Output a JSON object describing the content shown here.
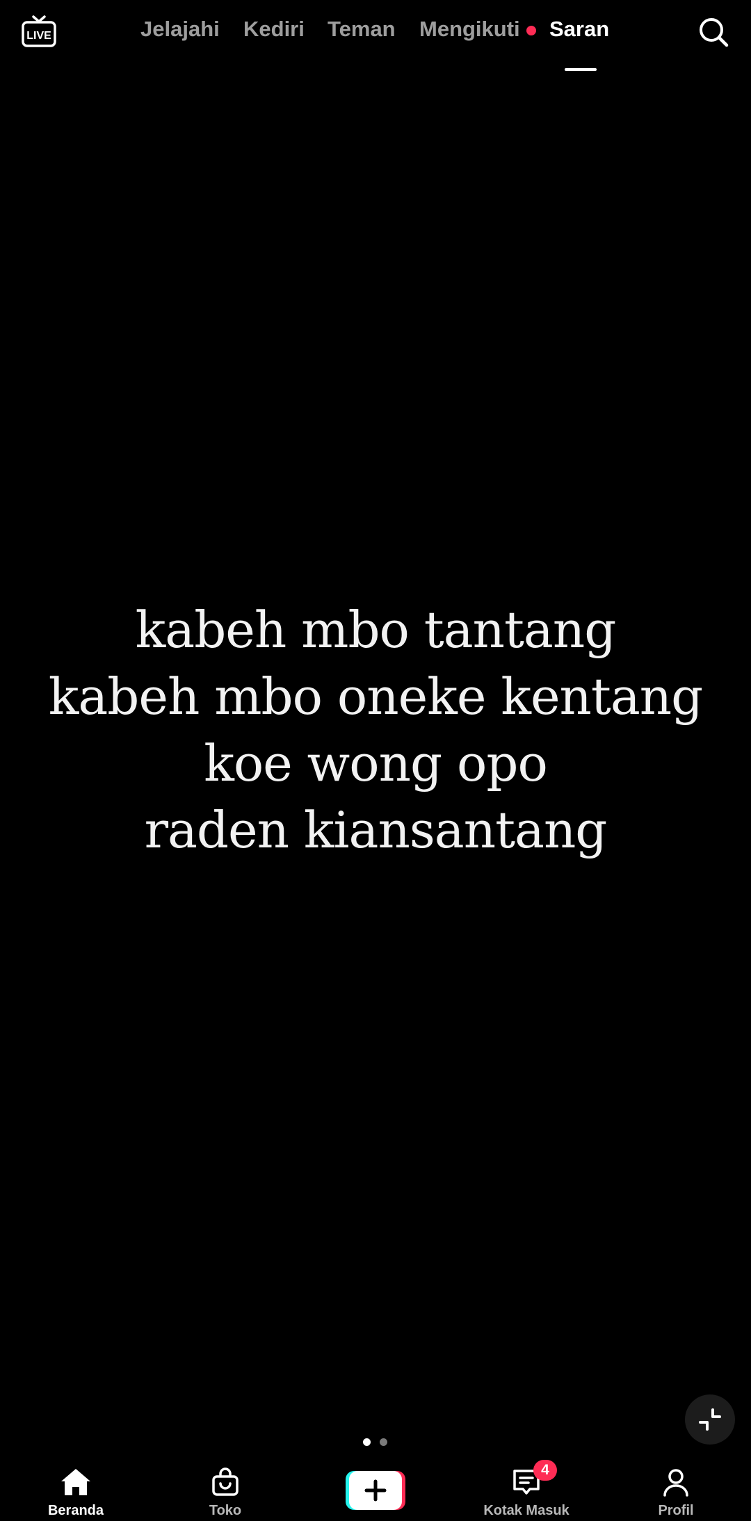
{
  "top_bar": {
    "live_icon_label": "LIVE",
    "tabs": [
      {
        "label": "Jelajahi",
        "active": false
      },
      {
        "label": "Kediri",
        "active": false
      },
      {
        "label": "Teman",
        "active": false
      },
      {
        "label": "Mengikuti",
        "active": false,
        "has_notification_dot": true
      },
      {
        "label": "Saran",
        "active": true
      }
    ],
    "search_icon": "search-icon"
  },
  "video": {
    "caption_lines": [
      "kabeh mbo tantang",
      "kabeh mbo oneke kentang",
      "koe wong opo",
      "raden kiansantang"
    ],
    "page_indicator": {
      "total": 2,
      "current": 1
    },
    "collapse_icon": "collapse-icon"
  },
  "bottom_nav": {
    "items": [
      {
        "label": "Beranda",
        "icon": "home-icon",
        "active": true
      },
      {
        "label": "Toko",
        "icon": "shop-bag-icon",
        "active": false
      },
      {
        "label": "",
        "icon": "plus-icon",
        "active": false
      },
      {
        "label": "Kotak Masuk",
        "icon": "inbox-icon",
        "active": false,
        "badge": "4"
      },
      {
        "label": "Profil",
        "icon": "profile-icon",
        "active": false
      }
    ]
  },
  "colors": {
    "background": "#000000",
    "accent_red": "#fe2c55",
    "accent_cyan": "#25f4ee",
    "text_primary": "#ffffff"
  }
}
